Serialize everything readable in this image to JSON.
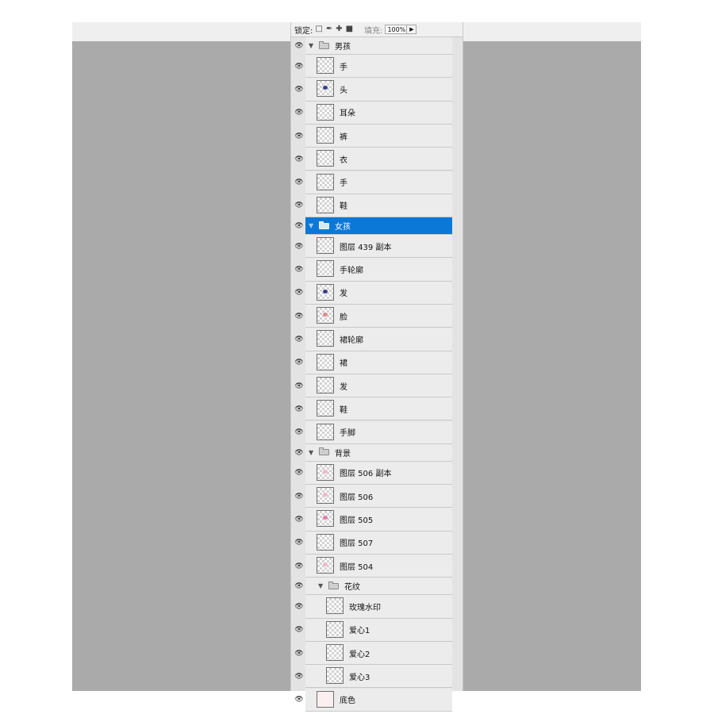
{
  "lock_bar": {
    "lock_label": "锁定:",
    "lock_icons": [
      "lock-transparent-icon",
      "lock-brush-icon",
      "lock-move-icon",
      "lock-all-icon"
    ],
    "fill_label": "填充:",
    "fill_value": "100%"
  },
  "layers": [
    {
      "type": "group",
      "name": "男孩",
      "depth": 0,
      "expanded": true,
      "selected": false
    },
    {
      "type": "layer",
      "name": "手",
      "depth": 1
    },
    {
      "type": "layer",
      "name": "头",
      "depth": 1,
      "thumb_mark": "#3a3f8c"
    },
    {
      "type": "layer",
      "name": "耳朵",
      "depth": 1
    },
    {
      "type": "layer",
      "name": "裤",
      "depth": 1
    },
    {
      "type": "layer",
      "name": "衣",
      "depth": 1
    },
    {
      "type": "layer",
      "name": "手",
      "depth": 1
    },
    {
      "type": "layer",
      "name": "鞋",
      "depth": 1
    },
    {
      "type": "group",
      "name": "女孩",
      "depth": 0,
      "expanded": true,
      "selected": true
    },
    {
      "type": "layer",
      "name": "图层 439 副本",
      "depth": 1
    },
    {
      "type": "layer",
      "name": "手轮廓",
      "depth": 1
    },
    {
      "type": "layer",
      "name": "发",
      "depth": 1,
      "thumb_mark": "#3a3f8c"
    },
    {
      "type": "layer",
      "name": "脸",
      "depth": 1,
      "thumb_mark": "#e08a8a"
    },
    {
      "type": "layer",
      "name": "裙轮廓",
      "depth": 1
    },
    {
      "type": "layer",
      "name": "裙",
      "depth": 1
    },
    {
      "type": "layer",
      "name": "发",
      "depth": 1
    },
    {
      "type": "layer",
      "name": "鞋",
      "depth": 1
    },
    {
      "type": "layer",
      "name": "手脚",
      "depth": 1
    },
    {
      "type": "group",
      "name": "背景",
      "depth": 0,
      "expanded": true,
      "selected": false
    },
    {
      "type": "layer",
      "name": "图层 506 副本",
      "depth": 1,
      "thumb_mark": "#f0b8c8"
    },
    {
      "type": "layer",
      "name": "图层 506",
      "depth": 1,
      "thumb_mark": "#f0b8c8"
    },
    {
      "type": "layer",
      "name": "图层 505",
      "depth": 1,
      "thumb_mark": "#e87aa8"
    },
    {
      "type": "layer",
      "name": "图层 507",
      "depth": 1
    },
    {
      "type": "layer",
      "name": "图层 504",
      "depth": 1,
      "thumb_mark": "#f3b8cc"
    },
    {
      "type": "group",
      "name": "花纹",
      "depth": 1,
      "expanded": true,
      "selected": false
    },
    {
      "type": "layer",
      "name": "玫瑰水印",
      "depth": 2
    },
    {
      "type": "layer",
      "name": "爱心1",
      "depth": 2
    },
    {
      "type": "layer",
      "name": "爱心2",
      "depth": 2
    },
    {
      "type": "layer",
      "name": "爱心3",
      "depth": 2
    },
    {
      "type": "layer",
      "name": "底色",
      "depth": 1,
      "thumb_fill": "#fbeff0"
    }
  ],
  "colors": {
    "selection": "#0b78d8",
    "canvas_bg": "#aaaaaa"
  }
}
